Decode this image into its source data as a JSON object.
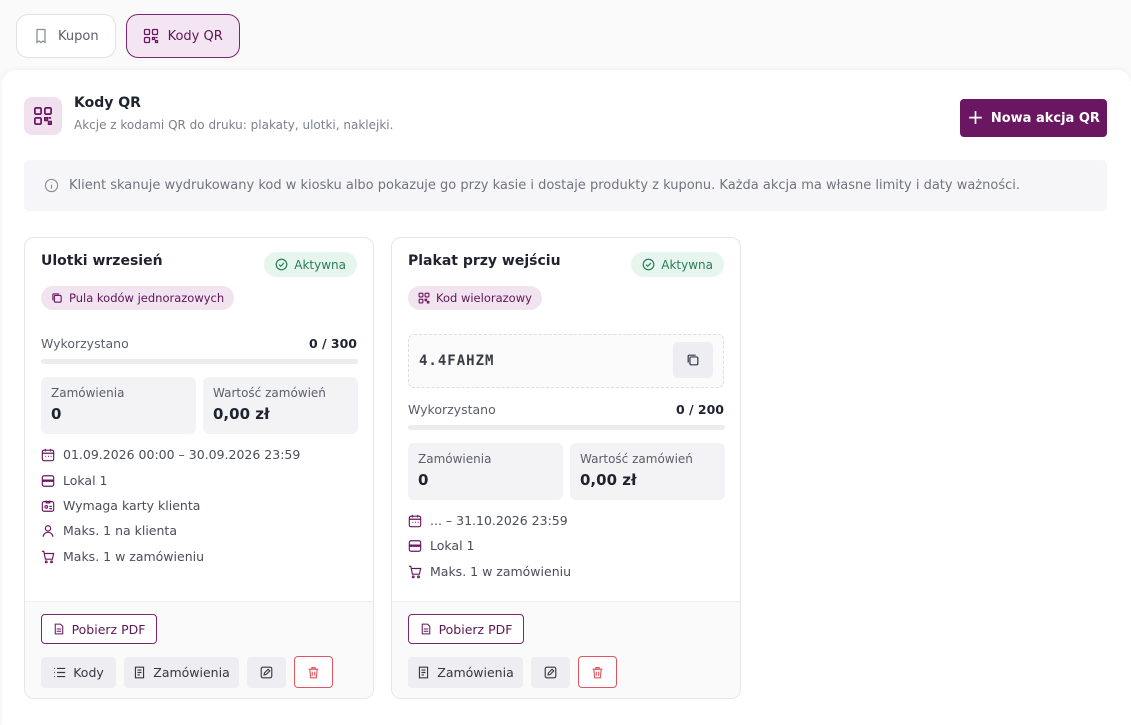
{
  "tabs": [
    {
      "label": "Kupon",
      "icon": "receipt-icon",
      "active": false
    },
    {
      "label": "Kody QR",
      "icon": "qr-icon",
      "active": true
    }
  ],
  "header": {
    "title": "Kody QR",
    "subtitle": "Akcje z kodami QR do druku: plakaty, ulotki, naklejki.",
    "new_button": "Nowa akcja QR"
  },
  "info": "Klient skanuje wydrukowany kod w kiosku albo pokazuje go przy kasie i dostaje produkty z kuponu. Każda akcja ma własne limity i daty ważności.",
  "colors": {
    "accent": "#6a1660",
    "status_bg": "#e6f6ee",
    "status_text": "#2a7d55",
    "danger": "#e05560"
  },
  "cards": [
    {
      "title": "Ulotki wrzesień",
      "status": "Aktywna",
      "type": "Pula kodów jednorazowych",
      "used_label": "Wykorzystano",
      "used_value": "0 / 300",
      "used_fraction": 0,
      "orders_label": "Zamówienia",
      "orders_value": "0",
      "worth_label": "Wartość zamówień",
      "worth_value": "0,00 zł",
      "meta": [
        {
          "icon": "calendar-icon",
          "text": "01.09.2026 00:00 – 30.09.2026 23:59"
        },
        {
          "icon": "store-icon",
          "text": "Lokal 1"
        },
        {
          "icon": "id-card-icon",
          "text": "Wymaga karty klienta"
        },
        {
          "icon": "user-icon",
          "text": "Maks. 1 na klienta"
        },
        {
          "icon": "cart-icon",
          "text": "Maks. 1 w zamówieniu"
        }
      ],
      "pdf": "Pobierz PDF",
      "codes_btn": "Kody",
      "orders_btn": "Zamówienia"
    },
    {
      "title": "Plakat przy wejściu",
      "status": "Aktywna",
      "type": "Kod wielorazowy",
      "code": "4.4FAHZM",
      "used_label": "Wykorzystano",
      "used_value": "0 / 200",
      "used_fraction": 0,
      "orders_label": "Zamówienia",
      "orders_value": "0",
      "worth_label": "Wartość zamówień",
      "worth_value": "0,00 zł",
      "meta": [
        {
          "icon": "calendar-icon",
          "text": "... – 31.10.2026 23:59"
        },
        {
          "icon": "store-icon",
          "text": "Lokal 1"
        },
        {
          "icon": "cart-icon",
          "text": "Maks. 1 w zamówieniu"
        }
      ],
      "pdf": "Pobierz PDF",
      "orders_btn": "Zamówienia"
    }
  ]
}
